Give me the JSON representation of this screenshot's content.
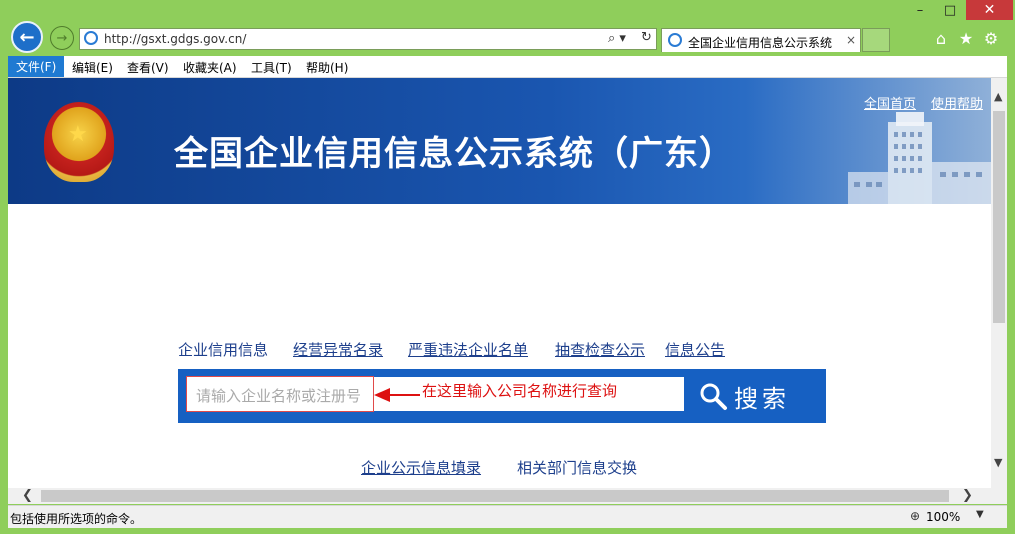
{
  "window": {
    "minimize": "–",
    "maximize": "□",
    "close": "✕"
  },
  "browser": {
    "url": "http://gsxt.gdgs.gov.cn/",
    "tab_title": "全国企业信用信息公示系统",
    "tab_close": "×",
    "search_icon": "search-icon",
    "refresh_icon": "refresh-icon",
    "tools": [
      "home-icon",
      "favorites-star-icon",
      "settings-gear-icon"
    ]
  },
  "menubar": {
    "items": [
      "文件(F)",
      "编辑(E)",
      "查看(V)",
      "收藏夹(A)",
      "工具(T)",
      "帮助(H)"
    ]
  },
  "banner": {
    "title": "全国企业信用信息公示系统（广东）",
    "home_link": "全国首页",
    "help_link": "使用帮助"
  },
  "nav_links": [
    "企业信用信息",
    "经营异常名录",
    "严重违法企业名单",
    "抽查检查公示",
    "信息公告"
  ],
  "search": {
    "placeholder": "请输入企业名称或注册号",
    "annotation": "在这里输入公司名称进行查询",
    "button_label": "搜索"
  },
  "bottom_links": [
    "企业公示信息填录",
    "相关部门信息交换"
  ],
  "statusbar": {
    "text": "包括使用所选项的命令。",
    "zoom": "100%"
  },
  "colors": {
    "chrome_green": "#8fce5b",
    "banner_blue": "#0d3a86",
    "search_blue": "#1660c2",
    "annotation_red": "#dd1111"
  }
}
